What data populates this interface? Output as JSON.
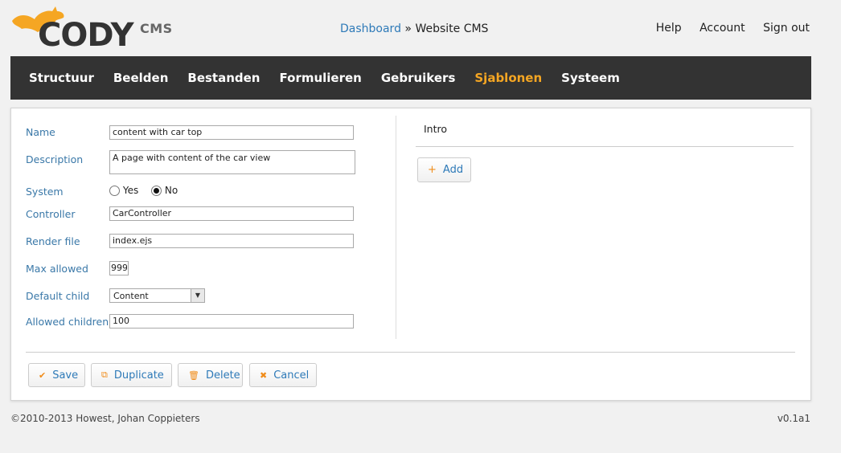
{
  "header": {
    "logo_text": "CODY",
    "logo_sub": "CMS",
    "breadcrumb": {
      "link": "Dashboard",
      "separator": " » ",
      "current": "Website CMS"
    },
    "links": [
      "Help",
      "Account",
      "Sign out"
    ]
  },
  "nav": {
    "items": [
      "Structuur",
      "Beelden",
      "Bestanden",
      "Formulieren",
      "Gebruikers",
      "Sjablonen",
      "Systeem"
    ],
    "active": "Sjablonen"
  },
  "form": {
    "name_label": "Name",
    "name_value": "content with car top",
    "description_label": "Description",
    "description_value": "A page with content of the car view",
    "system_label": "System",
    "system_yes": "Yes",
    "system_no": "No",
    "system_selected": "No",
    "controller_label": "Controller",
    "controller_value": "CarController",
    "render_label": "Render file",
    "render_value": "index.ejs",
    "max_label": "Max allowed",
    "max_value": "999",
    "default_child_label": "Default child",
    "default_child_value": "Content",
    "allowed_children_label": "Allowed children",
    "allowed_children_value": "100"
  },
  "right": {
    "intro": "Intro",
    "add_label": "Add"
  },
  "actions": {
    "save": "Save",
    "duplicate": "Duplicate",
    "delete": "Delete",
    "cancel": "Cancel"
  },
  "footer": {
    "copyright": "©2010-2013 Howest, Johan Coppieters",
    "version": "v0.1a1"
  },
  "colors": {
    "accent": "#f5a623",
    "link": "#2e7ab8",
    "nav_bg": "#333333"
  }
}
